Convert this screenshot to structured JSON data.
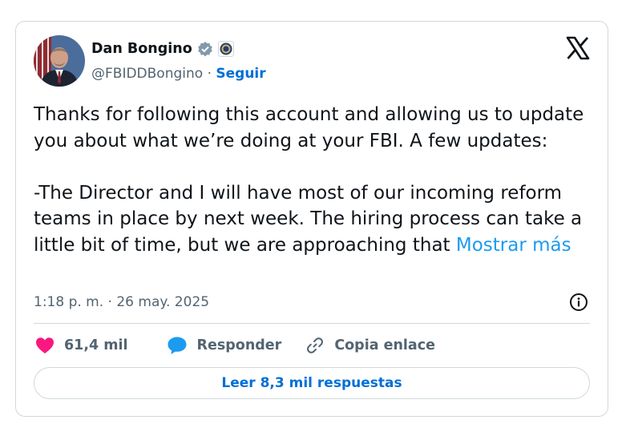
{
  "author": {
    "name": "Dan Bongino",
    "handle": "@FBIDDBongino",
    "separator": " · ",
    "follow_label": "Seguir",
    "verified_icon": "verified-badge-icon",
    "affiliation_icon": "fbi-seal-icon"
  },
  "platform_icon": "x-logo-icon",
  "tweet": {
    "text": "Thanks for following this account and allowing us to update you about what we’re doing at your FBI. A few updates:\n\n-The Director and I will have most of our incoming reform teams in place by next week. The hiring process can take a little bit of time, but we are approaching that ",
    "more_label": "Mostrar más",
    "timestamp": "1:18 p. m. · 26 may. 2025"
  },
  "actions": {
    "likes": "61,4 mil",
    "reply_label": "Responder",
    "copy_label": "Copia enlace"
  },
  "read_replies_label": "Leer 8,3 mil respuestas",
  "colors": {
    "accent": "#1d9bf0",
    "link": "#006fd6",
    "like": "#f91880",
    "muted": "#536471",
    "border": "#cfd9de"
  }
}
